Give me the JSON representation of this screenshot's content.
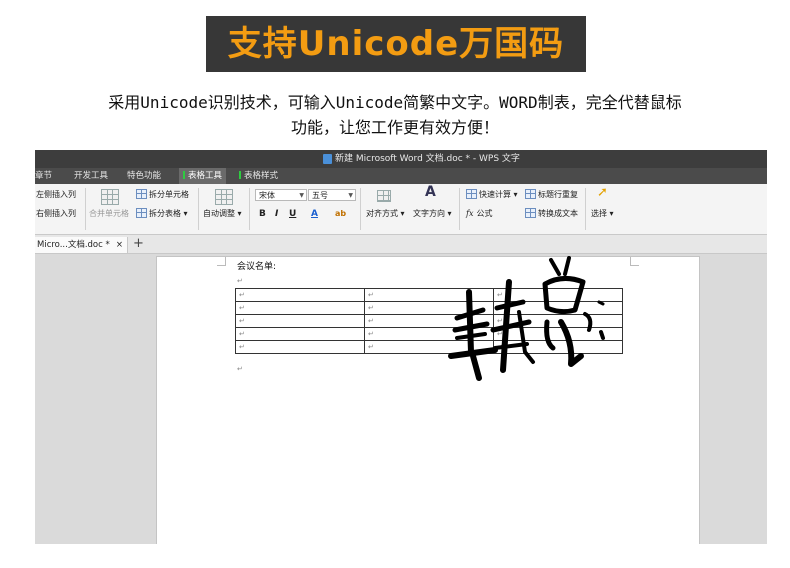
{
  "banner": {
    "title": "支持Unicode万国码"
  },
  "description": {
    "line1": "采用Unicode识别技术，可输入Unicode简繁中文字。WORD制表，完全代替鼠标",
    "line2": "功能，让您工作更有效方便！"
  },
  "window": {
    "title": "新建 Microsoft Word 文档.doc * - WPS 文字"
  },
  "menu": {
    "items": [
      "章节",
      "开发工具",
      "特色功能",
      "表格工具",
      "表格样式"
    ],
    "active": "表格工具"
  },
  "ribbon": {
    "insert_left": "左侧插入列",
    "insert_right": "右侧插入列",
    "merge_cells": "合并单元格",
    "split_cells": "拆分单元格",
    "split_table": "拆分表格",
    "autofit": "自动调整",
    "font": "宋体",
    "size": "五号",
    "bold": "B",
    "italic": "I",
    "underline": "U",
    "font_color": "A",
    "highlight": "ab",
    "align": "对齐方式",
    "text_dir": "文字方向",
    "quick_calc": "快速计算",
    "formula": "公式",
    "formula_icon": "fx",
    "repeat_header": "标题行重复",
    "to_text": "转换成文本",
    "select": "选择"
  },
  "tabs": {
    "doc_tab": "Micro...文档.doc *",
    "close": "×",
    "new": "+"
  },
  "document": {
    "heading": "会议名单:",
    "para_mark": "↵",
    "table": {
      "rows": 5,
      "cols": 3,
      "cell_mark": "↵"
    }
  },
  "signature": {
    "text": "韩总",
    "color": "#000000"
  },
  "colors": {
    "banner_bg": "#373737",
    "banner_text": "#f39c12",
    "menu_bg": "#4b4b4b",
    "accent_green": "#2ecc40"
  }
}
